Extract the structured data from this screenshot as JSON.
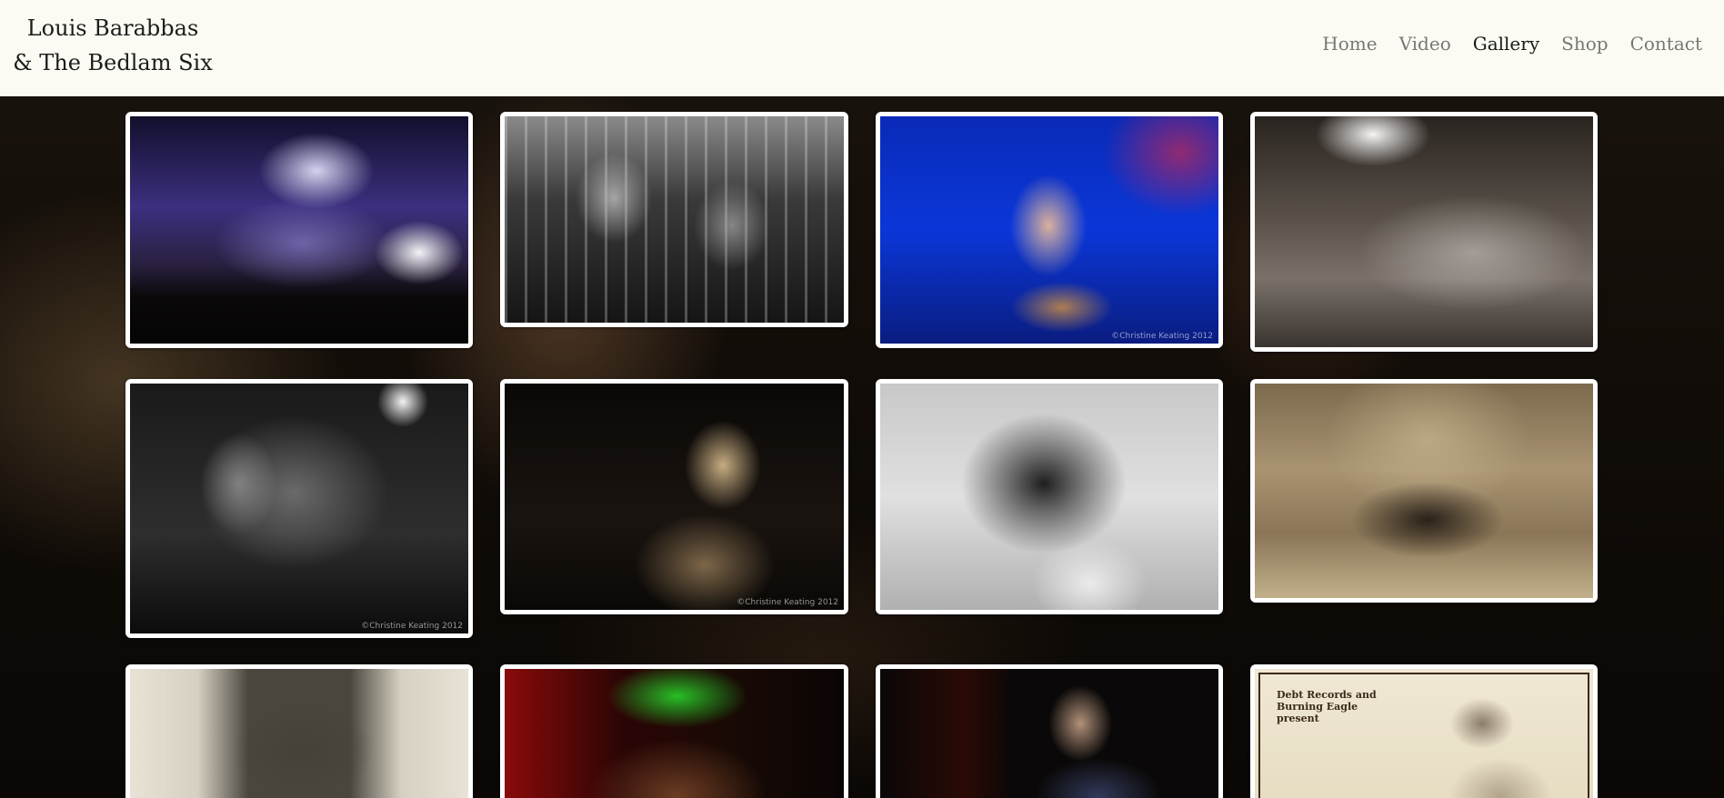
{
  "site": {
    "title_line1": "Louis Barabbas",
    "title_line2": "& The Bedlam Six"
  },
  "nav": {
    "items": [
      "Home",
      "Video",
      "Gallery",
      "Shop",
      "Contact"
    ],
    "active": "Gallery"
  },
  "gallery": {
    "credit": "©Christine Keating 2012",
    "poster_text": "Debt Records and Burning Eagle present"
  },
  "colors": {
    "header_bg": "#fbfbf3",
    "nav_inactive": "#777777",
    "nav_active": "#1a1a1a",
    "frame": "#ffffff"
  }
}
